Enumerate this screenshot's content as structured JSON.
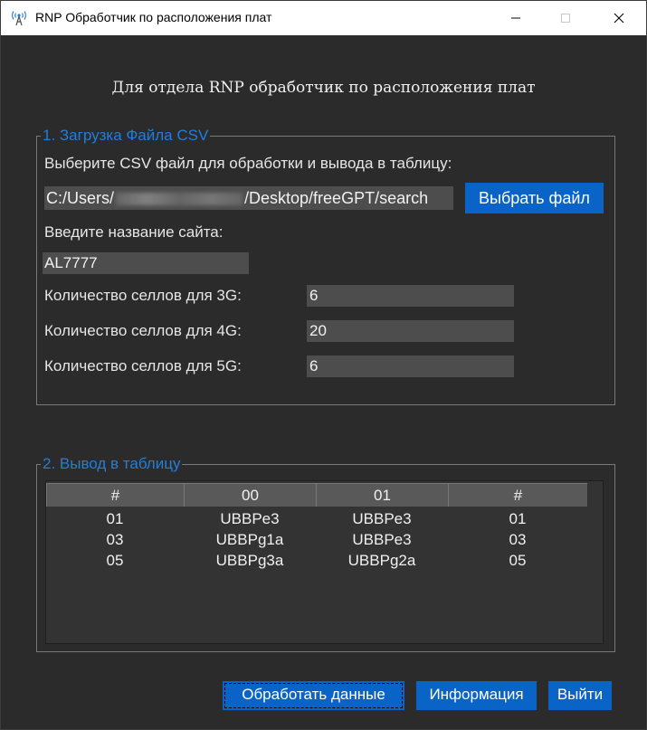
{
  "window": {
    "title": "RNP Обработчик по расположения плат"
  },
  "heading": "Для отдела RNP обработчик по расположения плат",
  "section1": {
    "legend": "1. Загрузка Файла CSV",
    "select_label": "Выберите CSV файл для обработки и вывода в таблицу:",
    "file_path_prefix": "C:/Users/",
    "file_path_suffix": "/Desktop/freeGPT/search",
    "choose_button": "Выбрать файл",
    "site_label": "Введите название сайта:",
    "site_value": "AL7777",
    "cells": [
      {
        "label": "Количество селлов для 3G:",
        "value": "6"
      },
      {
        "label": "Количество селлов для 4G:",
        "value": "20"
      },
      {
        "label": "Количество селлов для 5G:",
        "value": "6"
      }
    ]
  },
  "section2": {
    "legend": "2. Вывод в таблицу",
    "columns": [
      "#",
      "00",
      "01",
      "#"
    ],
    "rows": [
      [
        "01",
        "UBBPe3",
        "UBBPe3",
        "01"
      ],
      [
        "03",
        "UBBPg1a",
        "UBBPe3",
        "03"
      ],
      [
        "05",
        "UBBPg3a",
        "UBBPg2a",
        "05"
      ]
    ]
  },
  "buttons": {
    "process": "Обработать данные",
    "info": "Информация",
    "exit": "Выйти"
  },
  "colors": {
    "background": "#2b2b2b",
    "accent": "#0a64c8",
    "legend": "#1e7fe0",
    "field": "#4d4d4d"
  }
}
